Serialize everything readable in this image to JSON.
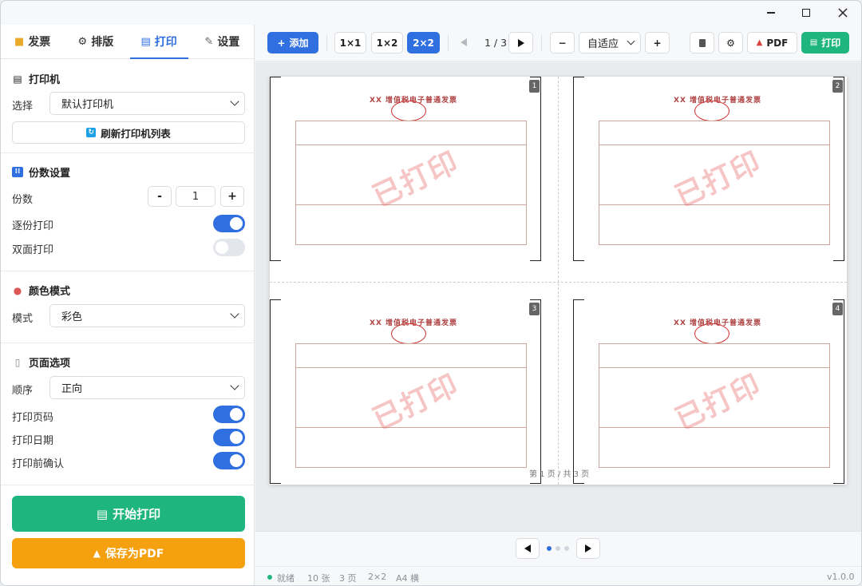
{
  "sidebar": {
    "tabs": [
      {
        "label": "发票",
        "icon": "folder-icon"
      },
      {
        "label": "排版",
        "icon": "gear-icon"
      },
      {
        "label": "打印",
        "icon": "printer-icon"
      },
      {
        "label": "设置",
        "icon": "wrench-icon"
      }
    ],
    "active_tab": "打印",
    "printer": {
      "title": "打印机",
      "select_label": "选择",
      "selected": "默认打印机",
      "refresh_label": "刷新打印机列表"
    },
    "copies": {
      "title": "份数设置",
      "count_label": "份数",
      "count_value": "1",
      "minus": "-",
      "plus": "+",
      "collate_label": "逐份打印",
      "collate_on": true,
      "duplex_label": "双面打印",
      "duplex_on": false
    },
    "color": {
      "title": "颜色模式",
      "mode_label": "模式",
      "mode_value": "彩色"
    },
    "page_options": {
      "title": "页面选项",
      "order_label": "顺序",
      "order_value": "正向",
      "print_page_no_label": "打印页码",
      "print_date_label": "打印日期",
      "confirm_label": "打印前确认"
    },
    "start_print_label": "开始打印",
    "save_pdf_label": "保存为PDF"
  },
  "toolbar": {
    "add_label": "添加",
    "layouts": [
      "1×1",
      "1×2",
      "2×2"
    ],
    "active_layout": "2×2",
    "page_indicator": "1 / 3",
    "zoom_minus": "−",
    "zoom_value": "自适应",
    "zoom_plus": "+",
    "pdf_label": "PDF",
    "print_label": "打印"
  },
  "preview": {
    "invoice_title": "XX 增值税电子普通发票",
    "stamp_text": "已打印",
    "cell_numbers": [
      "1",
      "2",
      "3",
      "4"
    ],
    "footer": "第 1 页 / 共 3 页"
  },
  "status": {
    "state": "就绪",
    "count": "10 张",
    "pages": "3 页",
    "layout": "2×2",
    "paper": "A4 横",
    "version": "v1.0.0"
  },
  "colors": {
    "accent": "#2f6fe0",
    "success": "#1fb57f",
    "warning": "#f5a00f"
  }
}
